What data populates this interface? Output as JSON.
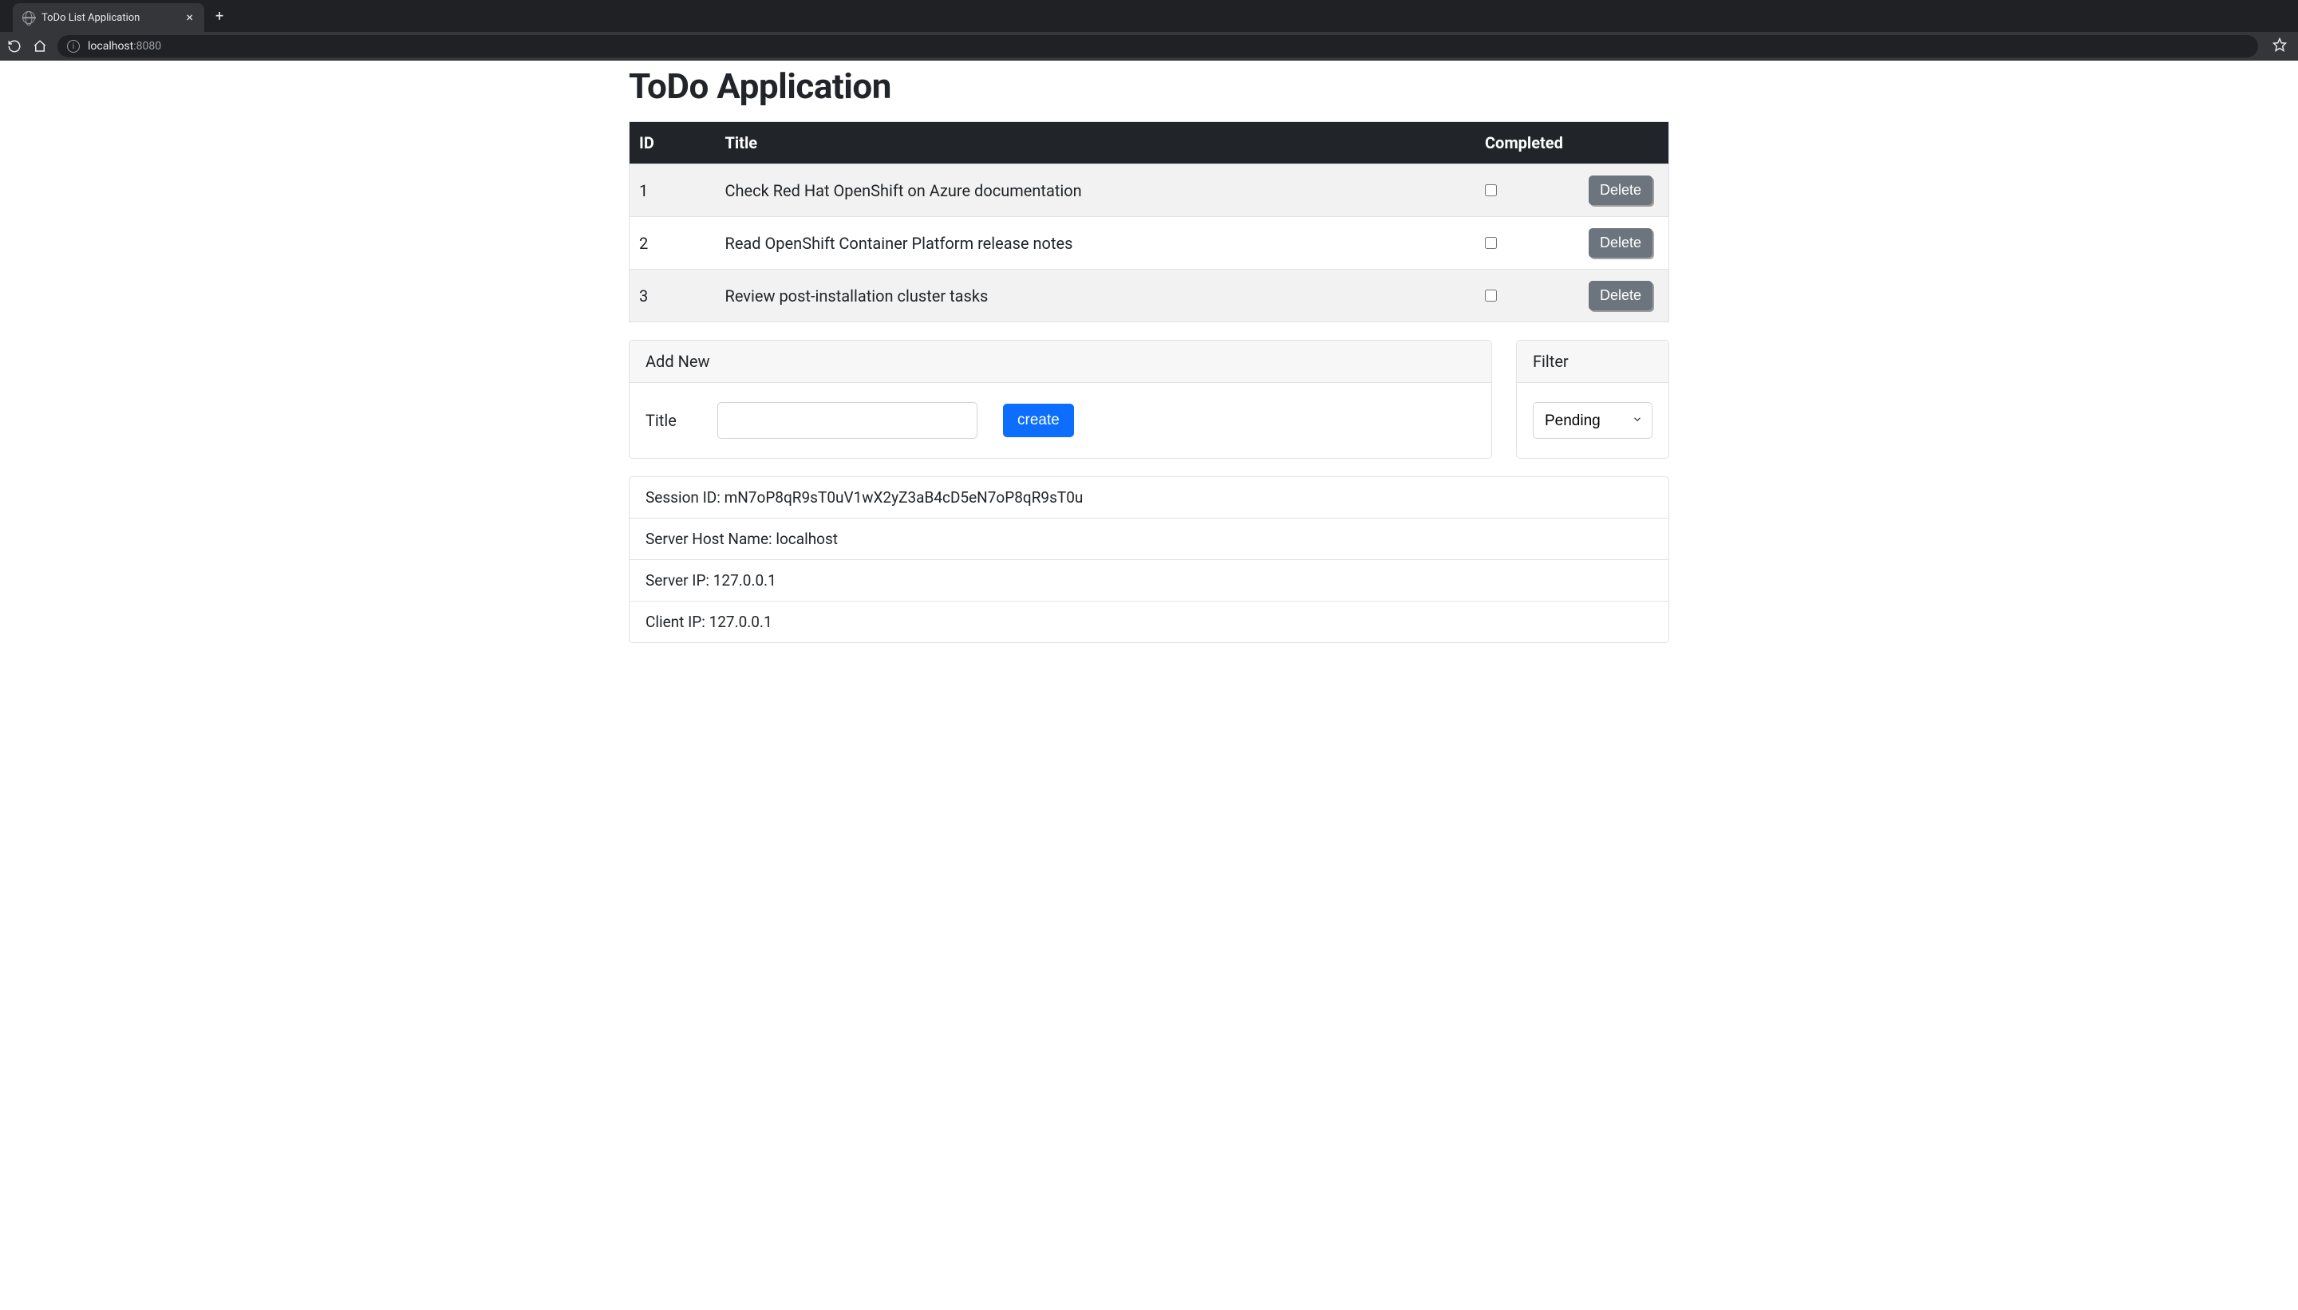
{
  "browser": {
    "tab_title": "ToDo List Application",
    "url_host": "localhost",
    "url_port": ":8080"
  },
  "app": {
    "title": "ToDo Application"
  },
  "table": {
    "headers": {
      "id": "ID",
      "title": "Title",
      "completed": "Completed"
    },
    "rows": [
      {
        "id": "1",
        "title": "Check Red Hat OpenShift on Azure documentation",
        "completed": false,
        "delete_label": "Delete"
      },
      {
        "id": "2",
        "title": "Read OpenShift Container Platform release notes",
        "completed": false,
        "delete_label": "Delete"
      },
      {
        "id": "3",
        "title": "Review post-installation cluster tasks",
        "completed": false,
        "delete_label": "Delete"
      }
    ]
  },
  "add_new": {
    "header": "Add New",
    "title_label": "Title",
    "title_value": "",
    "create_label": "create"
  },
  "filter": {
    "header": "Filter",
    "selected": "Pending"
  },
  "info": {
    "session_label": "Session ID:",
    "session_value": "mN7oP8qR9sT0uV1wX2yZ3aB4cD5eN7oP8qR9sT0u",
    "server_host_label": "Server Host Name:",
    "server_host_value": "localhost",
    "server_ip_label": "Server IP:",
    "server_ip_value": "127.0.0.1",
    "client_ip_label": "Client IP:",
    "client_ip_value": "127.0.0.1"
  }
}
